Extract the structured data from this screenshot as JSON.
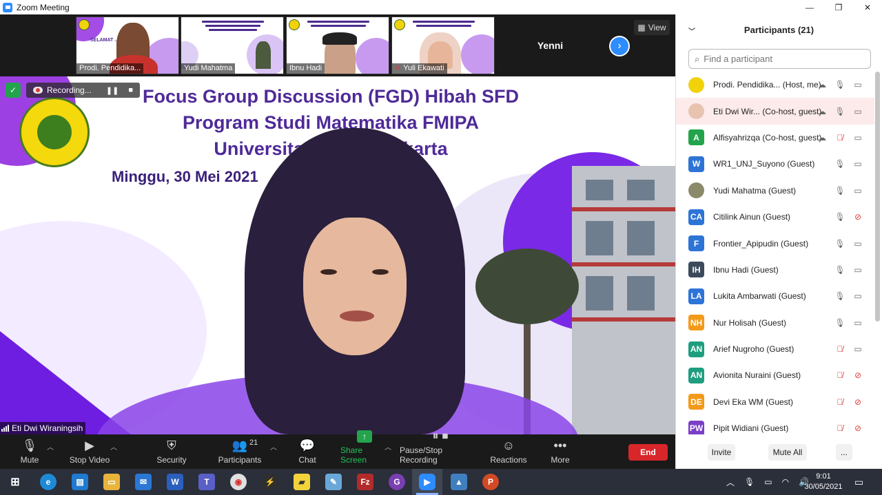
{
  "window": {
    "title": "Zoom Meeting",
    "minimize": "—",
    "maximize": "❐",
    "close": "✕"
  },
  "strip": {
    "thumbs": [
      {
        "name": "Prodi. Pendidika...",
        "muted": false
      },
      {
        "name": "Yudi Mahatma",
        "muted": false
      },
      {
        "name": "Ibnu Hadi",
        "muted": false
      },
      {
        "name": "Yuli Ekawati",
        "muted": true
      }
    ],
    "thumb0_caption": "SELAMAT ... PESERTA",
    "audio_only": "Yenni",
    "view_label": "View"
  },
  "main": {
    "recording_label": "Recording...",
    "slide_title_lines": [
      "Focus Group Discussion (FGD) Hibah SFD",
      "Program Studi Matematika FMIPA",
      "Universitas Negeri Jakarta"
    ],
    "slide_date": "Minggu, 30 Mei 2021",
    "speaker_name": "Eti Dwi Wiraningsih"
  },
  "toolbar": {
    "mute": "Mute",
    "stop_video": "Stop Video",
    "security": "Security",
    "participants": "Participants",
    "participants_count": "21",
    "chat": "Chat",
    "share_screen": "Share Screen",
    "pause_recording": "Pause/Stop Recording",
    "reactions": "Reactions",
    "more": "More",
    "end": "End"
  },
  "panel": {
    "title": "Participants (21)",
    "search_placeholder": "Find a participant",
    "participants": [
      {
        "name": "Prodi. Pendidika... (Host, me)",
        "initials": "",
        "color": "#f2d20a",
        "avatar": "logo",
        "cloud": true,
        "mic": "on",
        "video": "on",
        "highlight": false
      },
      {
        "name": "Eti Dwi Wir... (Co-host, guest)",
        "initials": "",
        "color": "#e8c3b0",
        "avatar": "photo",
        "cloud": true,
        "mic": "on",
        "video": "on",
        "highlight": true
      },
      {
        "name": "Alfisyahrizqa (Co-host, guest)",
        "initials": "A",
        "color": "#23a44c",
        "avatar": "initials",
        "cloud": true,
        "mic": "off",
        "video": "on",
        "highlight": false
      },
      {
        "name": "WR1_UNJ_Suyono (Guest)",
        "initials": "W",
        "color": "#2d74d6",
        "avatar": "initials",
        "cloud": false,
        "mic": "on",
        "video": "on",
        "highlight": false
      },
      {
        "name": "Yudi Mahatma (Guest)",
        "initials": "",
        "color": "#8a8a6a",
        "avatar": "photo",
        "cloud": false,
        "mic": "on",
        "video": "on",
        "highlight": false
      },
      {
        "name": "Citilink Ainun (Guest)",
        "initials": "CA",
        "color": "#2d74d6",
        "avatar": "initials",
        "cloud": false,
        "mic": "on",
        "video": "off",
        "highlight": false
      },
      {
        "name": "Frontier_Apipudin (Guest)",
        "initials": "F",
        "color": "#2d74d6",
        "avatar": "initials",
        "cloud": false,
        "mic": "on",
        "video": "on",
        "highlight": false
      },
      {
        "name": "Ibnu Hadi (Guest)",
        "initials": "IH",
        "color": "#3d4a5c",
        "avatar": "initials",
        "cloud": false,
        "mic": "on",
        "video": "on",
        "highlight": false
      },
      {
        "name": "Lukita Ambarwati (Guest)",
        "initials": "LA",
        "color": "#2d74d6",
        "avatar": "initials",
        "cloud": false,
        "mic": "on",
        "video": "on",
        "highlight": false
      },
      {
        "name": "Nur Holisah (Guest)",
        "initials": "NH",
        "color": "#f29a1a",
        "avatar": "initials",
        "cloud": false,
        "mic": "on",
        "video": "on",
        "highlight": false
      },
      {
        "name": "Arief Nugroho (Guest)",
        "initials": "AN",
        "color": "#1e9e7e",
        "avatar": "initials",
        "cloud": false,
        "mic": "off",
        "video": "on",
        "highlight": false
      },
      {
        "name": "Avionita Nuraini (Guest)",
        "initials": "AN",
        "color": "#1e9e7e",
        "avatar": "initials",
        "cloud": false,
        "mic": "off",
        "video": "off",
        "highlight": false
      },
      {
        "name": "Devi Eka WM (Guest)",
        "initials": "DE",
        "color": "#f29a1a",
        "avatar": "initials",
        "cloud": false,
        "mic": "off",
        "video": "off",
        "highlight": false
      },
      {
        "name": "Pipit Widiani  (Guest)",
        "initials": "PW",
        "color": "#7b3fc7",
        "avatar": "initials",
        "cloud": false,
        "mic": "off",
        "video": "off",
        "highlight": false
      }
    ],
    "invite": "Invite",
    "mute_all": "Mute All",
    "more": "..."
  },
  "taskbar": {
    "time": "9:01",
    "date": "30/05/2021"
  }
}
